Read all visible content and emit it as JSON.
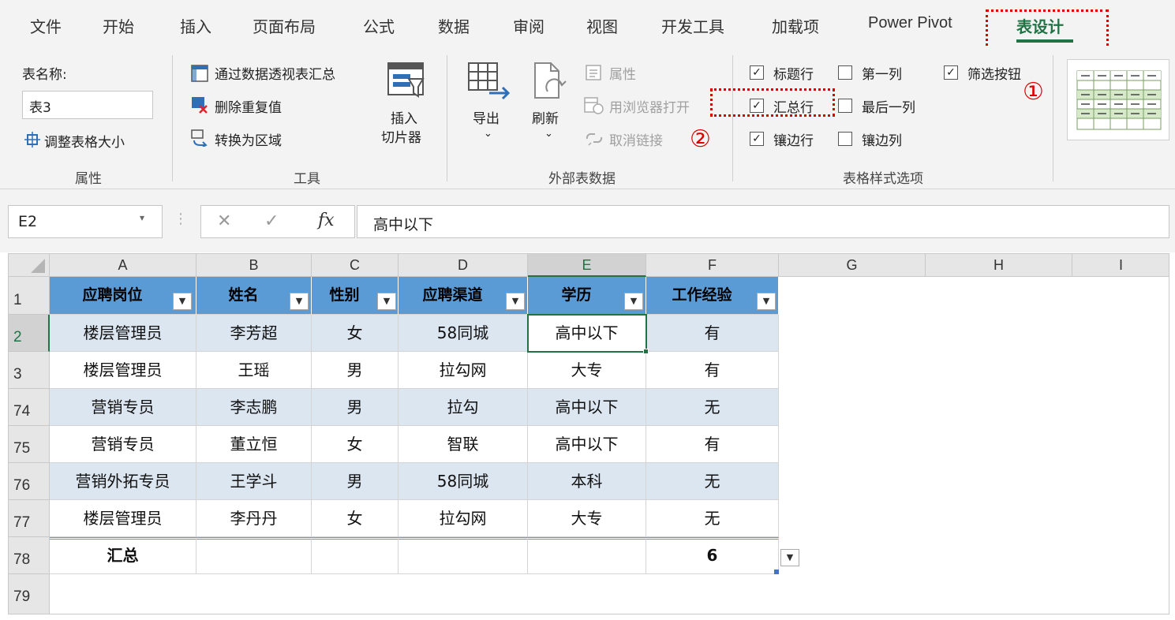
{
  "tabs": [
    {
      "label": "文件"
    },
    {
      "label": "开始"
    },
    {
      "label": "插入"
    },
    {
      "label": "页面布局"
    },
    {
      "label": "公式"
    },
    {
      "label": "数据"
    },
    {
      "label": "审阅"
    },
    {
      "label": "视图"
    },
    {
      "label": "开发工具"
    },
    {
      "label": "加载项"
    },
    {
      "label": "Power Pivot"
    },
    {
      "label": "表设计",
      "active": true
    }
  ],
  "ribbon": {
    "properties": {
      "table_name_label": "表名称:",
      "table_name_value": "表3",
      "resize_label": "调整表格大小",
      "group_label": "属性"
    },
    "tools": {
      "pivot_summary_label": "通过数据透视表汇总",
      "remove_duplicates_label": "删除重复值",
      "convert_range_label": "转换为区域",
      "insert_label": "插入",
      "slicer_label": "切片器",
      "group_label": "工具"
    },
    "external": {
      "export_label": "导出",
      "refresh_label": "刷新",
      "properties_label": "属性",
      "open_browser_label": "用浏览器打开",
      "unlink_label": "取消链接",
      "group_label": "外部表数据"
    },
    "style_options": {
      "header_row": {
        "label": "标题行",
        "checked": true
      },
      "first_column": {
        "label": "第一列",
        "checked": false
      },
      "filter_button": {
        "label": "筛选按钮",
        "checked": true
      },
      "total_row": {
        "label": "汇总行",
        "checked": true
      },
      "last_column": {
        "label": "最后一列",
        "checked": false
      },
      "banded_rows": {
        "label": "镶边行",
        "checked": true
      },
      "banded_columns": {
        "label": "镶边列",
        "checked": false
      },
      "group_label": "表格样式选项"
    },
    "annotations": {
      "marker_1": "①",
      "marker_2": "②"
    }
  },
  "formula_bar": {
    "name_box": "E2",
    "fx": "fx",
    "formula": "高中以下"
  },
  "grid": {
    "columns": [
      "A",
      "B",
      "C",
      "D",
      "E",
      "F",
      "G",
      "H",
      "I"
    ],
    "rows": [
      "1",
      "2",
      "3",
      "74",
      "75",
      "76",
      "77",
      "78",
      "79"
    ],
    "selected_cell": "E2",
    "table_headers": [
      "应聘岗位",
      "姓名",
      "性别",
      "应聘渠道",
      "学历",
      "工作经验"
    ],
    "table_rows": [
      [
        "楼层管理员",
        "李芳超",
        "女",
        "58同城",
        "高中以下",
        "有"
      ],
      [
        "楼层管理员",
        "王瑶",
        "男",
        "拉勾网",
        "大专",
        "有"
      ],
      [
        "营销专员",
        "李志鹏",
        "男",
        "拉勾",
        "高中以下",
        "无"
      ],
      [
        "营销专员",
        "董立恒",
        "女",
        "智联",
        "高中以下",
        "有"
      ],
      [
        "营销外拓专员",
        "王学斗",
        "男",
        "58同城",
        "本科",
        "无"
      ],
      [
        "楼层管理员",
        "李丹丹",
        "女",
        "拉勾网",
        "大专",
        "无"
      ]
    ],
    "total_row": [
      "汇总",
      "",
      "",
      "",
      "",
      "6"
    ]
  },
  "colors": {
    "accent": "#217346",
    "table_header": "#5b9bd5",
    "table_band": "#dce6f1",
    "annotation_red": "#e00000"
  }
}
